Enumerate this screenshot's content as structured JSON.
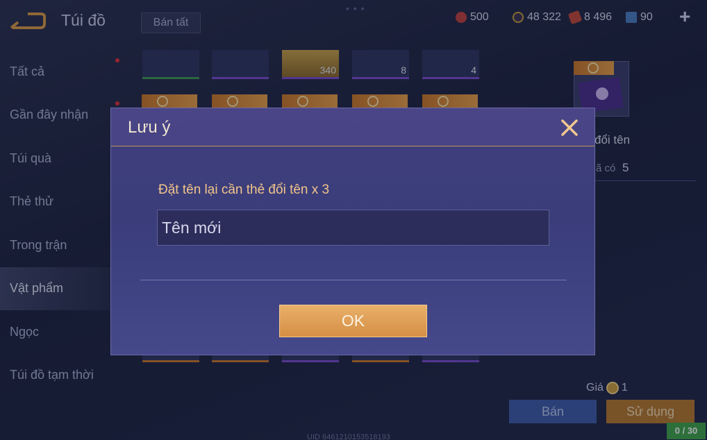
{
  "header": {
    "title": "Túi đồ",
    "sell_all_label": "Bán tất"
  },
  "currencies": [
    {
      "icon": "red-gem-icon",
      "value": "500",
      "color": "#c0433f"
    },
    {
      "icon": "gold-coin-icon",
      "value": "48 322",
      "color": "#c9a040"
    },
    {
      "icon": "red-voucher-icon",
      "value": "8 496",
      "color": "#c24a3a"
    },
    {
      "icon": "blue-card-icon",
      "value": "90",
      "color": "#4a7fc0"
    }
  ],
  "sidebar": {
    "items": [
      {
        "label": "Tất cả",
        "active": false
      },
      {
        "label": "Gần đây nhận",
        "active": false
      },
      {
        "label": "Túi quà",
        "active": false
      },
      {
        "label": "Thẻ thử",
        "active": false
      },
      {
        "label": "Trong trận",
        "active": false
      },
      {
        "label": "Vật phẩm",
        "active": true
      },
      {
        "label": "Ngọc",
        "active": false
      },
      {
        "label": "Túi đồ tạm thời",
        "active": false
      }
    ]
  },
  "inventory": {
    "row1_counts": [
      "",
      "",
      "340",
      "8",
      "4"
    ]
  },
  "detail": {
    "name_partial": "đổi tên",
    "owned_label": "ã có",
    "owned_value": "5",
    "price_label": "Giá",
    "price_value": "1",
    "sell_label": "Bán",
    "use_label": "Sử dụng"
  },
  "uid": "UID 6461210153518193",
  "counter": "0 / 30",
  "dialog": {
    "title": "Lưu ý",
    "prompt": "Đặt tên lại cần thẻ đổi tên x 3",
    "input_placeholder": "Tên mới",
    "ok_label": "OK"
  },
  "colors": {
    "accent_gold": "#d58f44",
    "dialog_bg": "#3a3d7a",
    "prompt_text": "#f2c58a"
  }
}
